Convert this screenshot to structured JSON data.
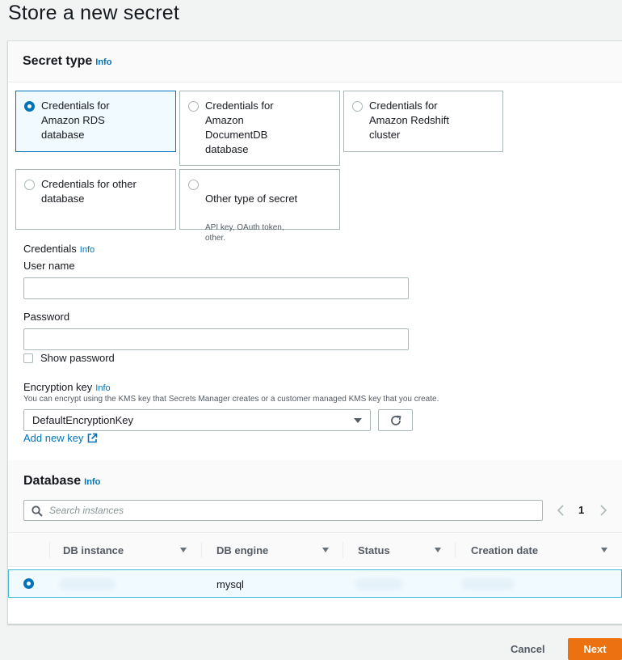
{
  "page": {
    "title": "Store a new secret"
  },
  "secret_type": {
    "heading": "Secret type",
    "info": "Info",
    "options": [
      {
        "label": "Credentials for\nAmazon RDS\ndatabase",
        "selected": true
      },
      {
        "label": "Credentials for\nAmazon\nDocumentDB\ndatabase",
        "selected": false
      },
      {
        "label": "Credentials for\nAmazon Redshift\ncluster",
        "selected": false
      },
      {
        "label": "Credentials for other\ndatabase",
        "selected": false
      },
      {
        "label": "Other type of secret",
        "sub": "API key, OAuth token,\nother.",
        "selected": false
      }
    ]
  },
  "credentials": {
    "label": "Credentials",
    "info": "Info",
    "username_label": "User name",
    "username_value": "",
    "password_label": "Password",
    "password_value": "",
    "show_password_label": "Show password",
    "show_password_checked": false
  },
  "encryption": {
    "label": "Encryption key",
    "info": "Info",
    "description": "You can encrypt using the KMS key that Secrets Manager creates or a customer managed KMS key that you create.",
    "selected_key": "DefaultEncryptionKey",
    "add_new_key": "Add new key"
  },
  "database": {
    "heading": "Database",
    "info": "Info",
    "search_placeholder": "Search instances",
    "page_number": "1",
    "columns": [
      "DB instance",
      "DB engine",
      "Status",
      "Creation date"
    ],
    "rows": [
      {
        "db_instance": "",
        "db_engine": "mysql",
        "status": "",
        "creation_date": "",
        "selected": true
      }
    ]
  },
  "footer": {
    "cancel": "Cancel",
    "next": "Next"
  },
  "colors": {
    "accent": "#0073bb",
    "primary_button": "#ec7211",
    "selected_row_border": "#44b9d6"
  }
}
